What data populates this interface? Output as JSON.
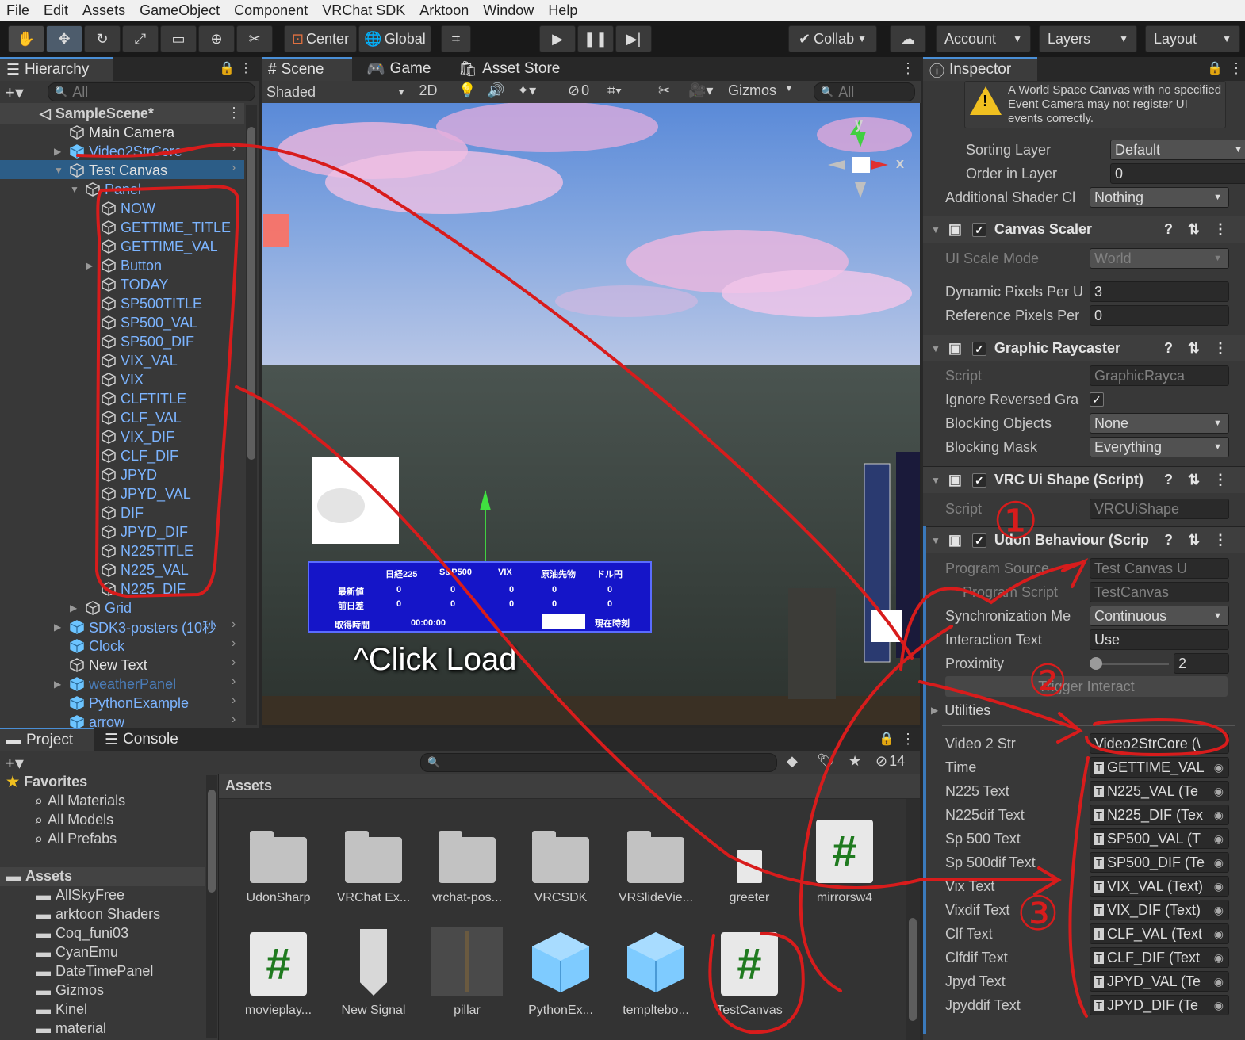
{
  "menu": [
    "File",
    "Edit",
    "Assets",
    "GameObject",
    "Component",
    "VRChat SDK",
    "Arktoon",
    "Window",
    "Help"
  ],
  "toolbar": {
    "center": "Center",
    "global": "Global",
    "collab": "Collab",
    "account": "Account",
    "layers": "Layers",
    "layout": "Layout"
  },
  "hierarchy": {
    "tab": "Hierarchy",
    "search_placeholder": "All",
    "scene": "SampleScene*",
    "items": [
      {
        "label": "Main Camera",
        "color": "white"
      },
      {
        "label": "Video2StrCore",
        "color": "blue"
      },
      {
        "label": "Test Canvas",
        "color": "white"
      },
      {
        "label": "Panel",
        "color": "blue"
      },
      {
        "label": "NOW",
        "color": "blue"
      },
      {
        "label": "GETTIME_TITLE",
        "color": "blue"
      },
      {
        "label": "GETTIME_VAL",
        "color": "blue"
      },
      {
        "label": "Button",
        "color": "blue"
      },
      {
        "label": "TODAY",
        "color": "blue"
      },
      {
        "label": "SP500TITLE",
        "color": "blue"
      },
      {
        "label": "SP500_VAL",
        "color": "blue"
      },
      {
        "label": "SP500_DIF",
        "color": "blue"
      },
      {
        "label": "VIX_VAL",
        "color": "blue"
      },
      {
        "label": "VIX",
        "color": "blue"
      },
      {
        "label": "CLFTITLE",
        "color": "blue"
      },
      {
        "label": "CLF_VAL",
        "color": "blue"
      },
      {
        "label": "VIX_DIF",
        "color": "blue"
      },
      {
        "label": "CLF_DIF",
        "color": "blue"
      },
      {
        "label": "JPYD",
        "color": "blue"
      },
      {
        "label": "JPYD_VAL",
        "color": "blue"
      },
      {
        "label": "DIF",
        "color": "blue"
      },
      {
        "label": "JPYD_DIF",
        "color": "blue"
      },
      {
        "label": "N225TITLE",
        "color": "blue"
      },
      {
        "label": "N225_VAL",
        "color": "blue"
      },
      {
        "label": "N225_DIF",
        "color": "blue"
      },
      {
        "label": "Grid",
        "color": "blue"
      },
      {
        "label": "SDK3-posters (10秒",
        "color": "blue"
      },
      {
        "label": "Clock",
        "color": "blue"
      },
      {
        "label": "New Text",
        "color": "white"
      },
      {
        "label": "weatherPanel",
        "color": "dimblue"
      },
      {
        "label": "PythonExample",
        "color": "blue"
      },
      {
        "label": "arrow",
        "color": "blue"
      }
    ]
  },
  "scene": {
    "tabs": [
      "Scene",
      "Game",
      "Asset Store"
    ],
    "shading": "Shaded",
    "mode2d": "2D",
    "hidden_count": "0",
    "gizmos": "Gizmos",
    "search_placeholder": "All",
    "axis_y": "y",
    "axis_x": "x",
    "click_load": "^Click Load",
    "board": {
      "headers": [
        "日経225",
        "S&P500",
        "VIX",
        "原油先物",
        "ドル円"
      ],
      "row1_label": "最新値",
      "row2_label": "前日差",
      "row1": [
        "0",
        "0",
        "0",
        "0",
        "0"
      ],
      "row2": [
        "0",
        "0",
        "0",
        "0",
        "0"
      ],
      "time_label": "取得時間",
      "time_value": "00:00:00",
      "now_label": "現在時刻"
    }
  },
  "inspector": {
    "tab": "Inspector",
    "warning": "A World Space Canvas with no specified Event Camera may not register UI events correctly.",
    "rows_top": [
      {
        "label": "Sorting Layer",
        "value": "Default",
        "drop": true
      },
      {
        "label": "Order in Layer",
        "value": "0",
        "drop": false
      },
      {
        "label": "Additional Shader Cl",
        "value": "Nothing",
        "drop": true
      }
    ],
    "canvas_scaler": {
      "title": "Canvas Scaler",
      "rows": [
        {
          "label": "UI Scale Mode",
          "value": "World",
          "drop": true,
          "dim": true
        },
        {
          "label": "Dynamic Pixels Per U",
          "value": "3",
          "drop": false
        },
        {
          "label": "Reference Pixels Per",
          "value": "0",
          "drop": false
        }
      ]
    },
    "raycaster": {
      "title": "Graphic Raycaster",
      "rows": [
        {
          "label": "Script",
          "value": "GraphicRayca",
          "drop": false,
          "dim": true
        },
        {
          "label": "Ignore Reversed Gra",
          "value": "✓",
          "check": true
        },
        {
          "label": "Blocking Objects",
          "value": "None",
          "drop": true
        },
        {
          "label": "Blocking Mask",
          "value": "Everything",
          "drop": true
        }
      ]
    },
    "vrc_ui_shape": {
      "title": "VRC Ui Shape (Script)",
      "script_label": "Script",
      "script_value": "VRCUiShape"
    },
    "udon": {
      "title": "Udon Behaviour (Scrip",
      "rows": [
        {
          "label": "Program Source",
          "value": "Test Canvas U",
          "dim": true
        },
        {
          "label": "Program Script",
          "value": "TestCanvas",
          "dim": true,
          "indent": true
        },
        {
          "label": "Synchronization Me",
          "value": "Continuous",
          "drop": true
        },
        {
          "label": "Interaction Text",
          "value": "Use"
        },
        {
          "label": "Proximity",
          "value": "2",
          "slider": 0.0
        }
      ],
      "trigger": "Trigger Interact",
      "utilities": "Utilities"
    },
    "fields": [
      {
        "label": "Video 2 Str",
        "value": "Video2StrCore (\\"
      },
      {
        "label": "Time",
        "value": "GETTIME_VAL"
      },
      {
        "label": "N225 Text",
        "value": "N225_VAL (Te"
      },
      {
        "label": "N225dif Text",
        "value": "N225_DIF (Tex"
      },
      {
        "label": "Sp 500 Text",
        "value": "SP500_VAL (T"
      },
      {
        "label": "Sp 500dif Text",
        "value": "SP500_DIF (Te"
      },
      {
        "label": "Vix Text",
        "value": "VIX_VAL (Text)"
      },
      {
        "label": "Vixdif Text",
        "value": "VIX_DIF (Text)"
      },
      {
        "label": "Clf Text",
        "value": "CLF_VAL (Text"
      },
      {
        "label": "Clfdif Text",
        "value": "CLF_DIF (Text"
      },
      {
        "label": "Jpyd Text",
        "value": "JPYD_VAL (Te"
      },
      {
        "label": "Jpyddif Text",
        "value": "JPYD_DIF (Te"
      }
    ],
    "annotations": [
      "①",
      "②",
      "③"
    ]
  },
  "project": {
    "tabs": [
      "Project",
      "Console"
    ],
    "hidden_count": "14",
    "favorites_title": "Favorites",
    "favorites": [
      "All Materials",
      "All Models",
      "All Prefabs"
    ],
    "assets_title": "Assets",
    "tree": [
      "AllSkyFree",
      "arktoon Shaders",
      "Coq_funi03",
      "CyanEmu",
      "DateTimePanel",
      "Gizmos",
      "Kinel",
      "material"
    ],
    "breadcrumb": "Assets",
    "assets_row1": [
      {
        "name": "UdonSharp",
        "kind": "folder"
      },
      {
        "name": "VRChat Ex...",
        "kind": "folder"
      },
      {
        "name": "vrchat-pos...",
        "kind": "folder"
      },
      {
        "name": "VRCSDK",
        "kind": "folder"
      },
      {
        "name": "VRSlideVie...",
        "kind": "folder"
      },
      {
        "name": "greeter",
        "kind": "doc"
      },
      {
        "name": "mirrorsw4",
        "kind": "script"
      }
    ],
    "assets_row2": [
      {
        "name": "movieplay...",
        "kind": "script"
      },
      {
        "name": "New Signal",
        "kind": "signal"
      },
      {
        "name": "pillar",
        "kind": "pillar"
      },
      {
        "name": "PythonEx...",
        "kind": "cube"
      },
      {
        "name": "templtebo...",
        "kind": "cube"
      },
      {
        "name": "TestCanvas",
        "kind": "script"
      }
    ]
  },
  "colors": {
    "annotation": "#d81c1c",
    "hierarchy_selected": "#2c5d87",
    "link_blue": "#7cb4ff"
  }
}
